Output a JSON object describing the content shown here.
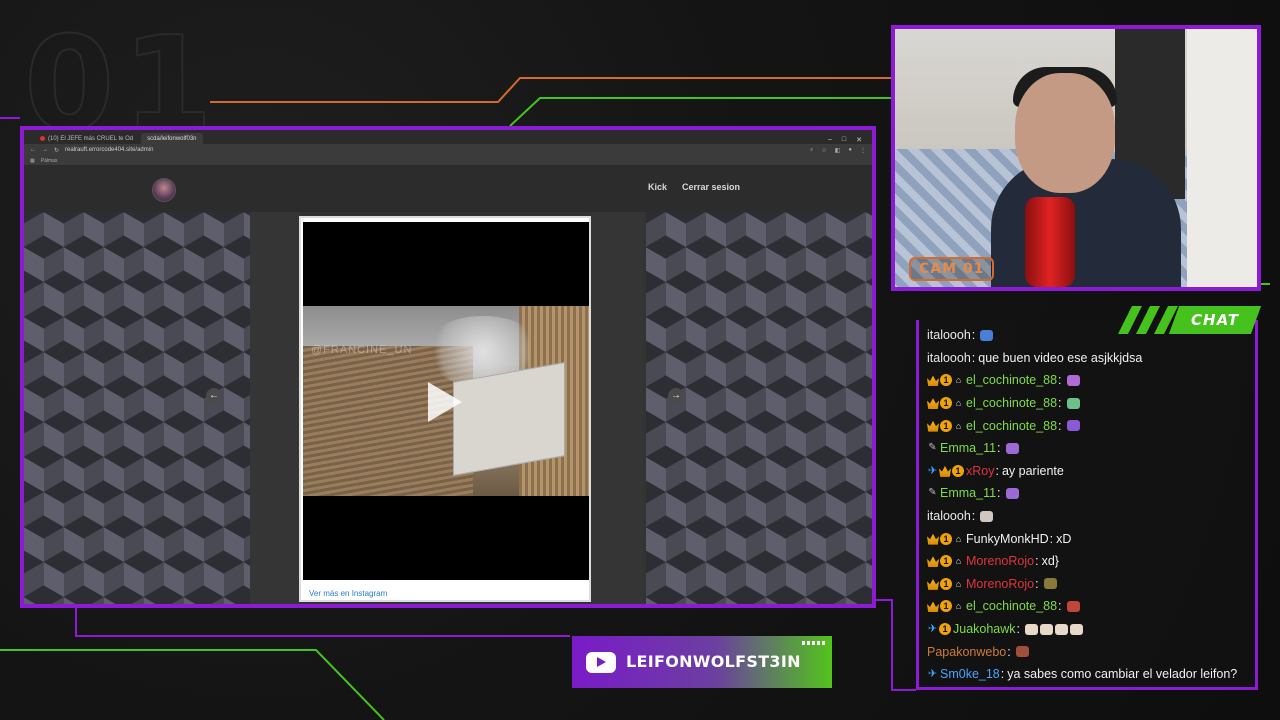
{
  "overlay": {
    "bg_number": "01",
    "accent": "#8d1bd6",
    "accent_orange": "#d46a2c",
    "accent_green": "#46c21f"
  },
  "browser": {
    "tabs": [
      {
        "label": "(10) El JEFE más CRUEL te Od",
        "active": false
      },
      {
        "label": "scda/leifonwolf03n",
        "active": true
      }
    ],
    "url": "realrauft.errorcode404.site/admin",
    "bookmark": "Pálmas"
  },
  "site": {
    "nav_links": [
      "Kick",
      "Cerrar sesion"
    ],
    "embed_watermark": "@FRANCINE_UN",
    "instagram_link": "Ver más en Instagram",
    "prev_icon": "arrow-left-icon",
    "next_icon": "arrow-right-icon"
  },
  "webcam": {
    "label": "CAM 01"
  },
  "chat": {
    "title": "CHAT",
    "messages": [
      {
        "badges": [],
        "user": "italoooh",
        "color": "#e8e8e8",
        "text": "",
        "emotes": [
          "#4a7fd6"
        ]
      },
      {
        "badges": [],
        "user": "italoooh",
        "color": "#e8e8e8",
        "text": "que buen video ese asjkkjdsa",
        "emotes": []
      },
      {
        "badges": [
          "crown",
          "one",
          "cam"
        ],
        "user": "el_cochinote_88",
        "color": "#7fdc4a",
        "text": "",
        "emotes": [
          "#b06ad6"
        ]
      },
      {
        "badges": [
          "crown",
          "one",
          "cam"
        ],
        "user": "el_cochinote_88",
        "color": "#7fdc4a",
        "text": "",
        "emotes": [
          "#6cc08a"
        ]
      },
      {
        "badges": [
          "crown",
          "one",
          "cam"
        ],
        "user": "el_cochinote_88",
        "color": "#7fdc4a",
        "text": "",
        "emotes": [
          "#8a5ad6"
        ]
      },
      {
        "badges": [
          "tool"
        ],
        "user": "Emma_11",
        "color": "#7fdc4a",
        "text": "",
        "emotes": [
          "#9a6ad6"
        ]
      },
      {
        "badges": [
          "sword",
          "crown",
          "one"
        ],
        "user": "xRoy",
        "color": "#e0353d",
        "text": "ay pariente",
        "emotes": []
      },
      {
        "badges": [
          "tool"
        ],
        "user": "Emma_11",
        "color": "#7fdc4a",
        "text": "",
        "emotes": [
          "#9a6ad6"
        ]
      },
      {
        "badges": [],
        "user": "italoooh",
        "color": "#e8e8e8",
        "text": "",
        "emotes": [
          "#d0c8c0"
        ]
      },
      {
        "badges": [
          "crown",
          "one",
          "cam"
        ],
        "user": "FunkyMonkHD",
        "color": "#f1f1f1",
        "text": "xD",
        "emotes": []
      },
      {
        "badges": [
          "crown",
          "one",
          "cam"
        ],
        "user": "MorenoRojo",
        "color": "#e0353d",
        "text": "xd}",
        "emotes": []
      },
      {
        "badges": [
          "crown",
          "one",
          "cam"
        ],
        "user": "MorenoRojo",
        "color": "#e0353d",
        "text": "",
        "emotes": [
          "#8a7a3a"
        ]
      },
      {
        "badges": [
          "crown",
          "one",
          "cam"
        ],
        "user": "el_cochinote_88",
        "color": "#7fdc4a",
        "text": "",
        "emotes": [
          "#c0453a"
        ]
      },
      {
        "badges": [
          "sword",
          "one"
        ],
        "user": "Juakohawk",
        "color": "#7fdc4a",
        "text": "",
        "emotes": [
          "#e8d8c8",
          "#e8d8c8",
          "#e8d8c8",
          "#e8d8c8"
        ]
      },
      {
        "badges": [],
        "user": "Papakonwebo",
        "color": "#ce7b3c",
        "text": "",
        "emotes": [
          "#a0503a"
        ]
      },
      {
        "badges": [
          "sword"
        ],
        "user": "Sm0ke_18",
        "color": "#4aa3ff",
        "text": "ya sabes como cambiar el velador leifon?",
        "emotes": []
      }
    ]
  },
  "youtube": {
    "channel": "LEIFONWOLFST3IN",
    "icon": "youtube-icon"
  }
}
